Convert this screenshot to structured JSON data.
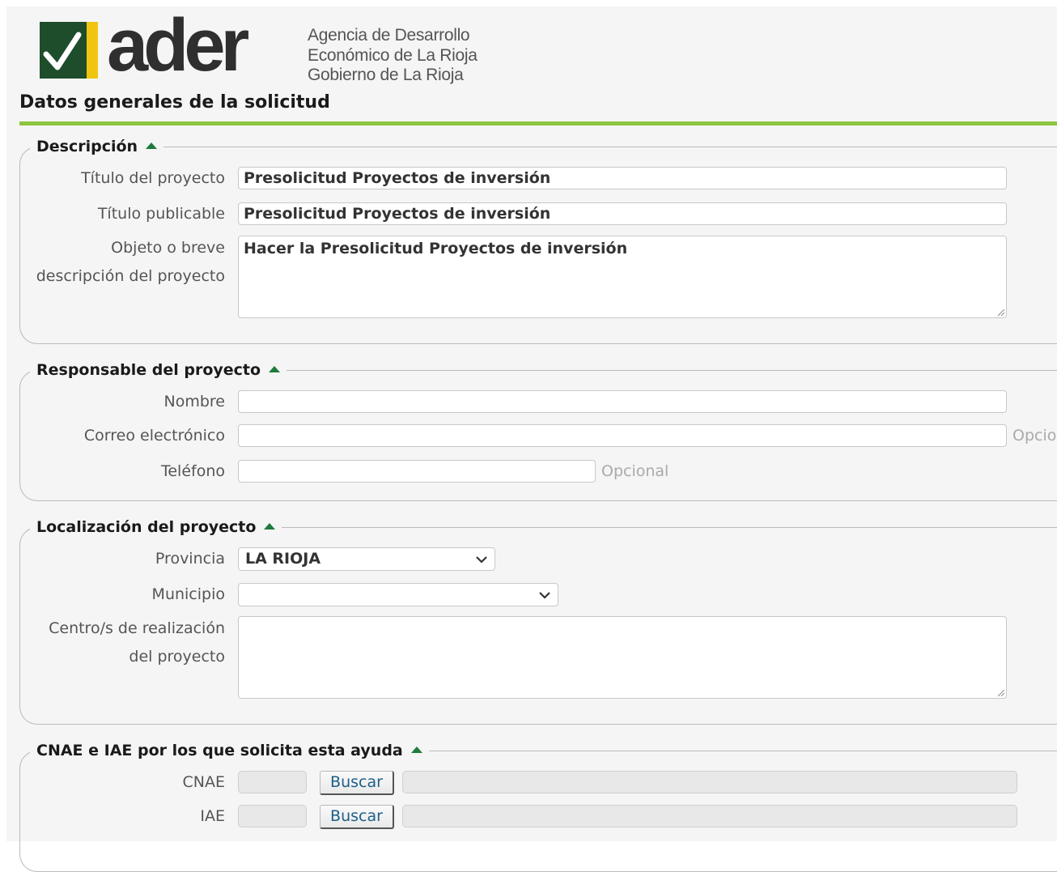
{
  "header": {
    "logo_text": "ader",
    "agency_lines": [
      "Agencia de Desarrollo",
      "Económico de La Rioja",
      "Gobierno de La Rioja"
    ],
    "page_title": "Datos generales de la solicitud",
    "accent_color": "#8cc63f"
  },
  "descripcion": {
    "legend": "Descripción",
    "titulo_label": "Título del proyecto",
    "titulo_value": "Presolicitud Proyectos de inversión",
    "publicable_label": "Título publicable",
    "publicable_value": "Presolicitud Proyectos de inversión",
    "objeto_label_1": "Objeto o breve",
    "objeto_label_2": "descripción del proyecto",
    "objeto_value": "Hacer la Presolicitud Proyectos de inversión"
  },
  "responsable": {
    "legend": "Responsable del proyecto",
    "nombre_label": "Nombre",
    "nombre_value": "",
    "correo_label": "Correo electrónico",
    "correo_value": "",
    "correo_hint": "Opcional",
    "telefono_label": "Teléfono",
    "telefono_value": "",
    "telefono_hint": "Opcional"
  },
  "localizacion": {
    "legend": "Localización del proyecto",
    "provincia_label": "Provincia",
    "provincia_value": "LA RIOJA",
    "municipio_label": "Municipio",
    "municipio_value": "",
    "centro_label_1": "Centro/s de realización",
    "centro_label_2": "del proyecto",
    "centro_value": ""
  },
  "cnae_iae": {
    "legend": "CNAE e IAE por los que solicita esta ayuda",
    "cnae_label": "CNAE",
    "iae_label": "IAE",
    "buscar_label": "Buscar"
  }
}
